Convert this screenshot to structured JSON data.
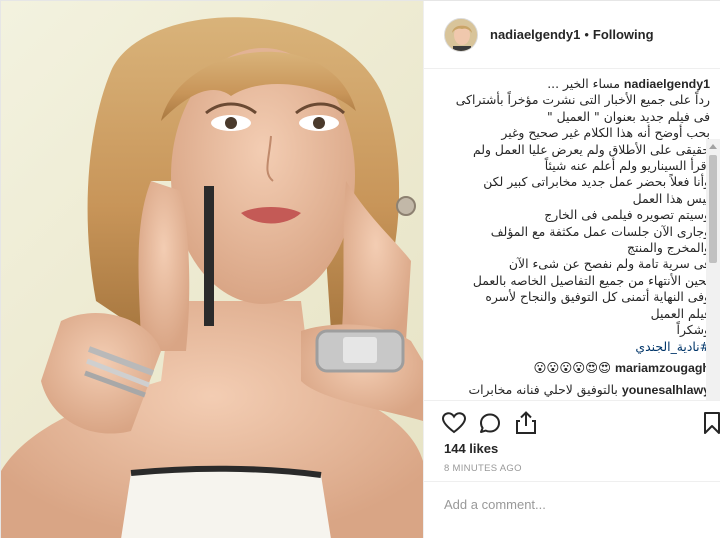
{
  "header": {
    "username": "nadiaelgendy1",
    "separator": "•",
    "follow_status": "Following"
  },
  "caption": {
    "username": "nadiaelgendy1",
    "lines": [
      "مساء الخير ...",
      "رداً على جميع الأخبار التى نشرت مؤخراً بأشتراكى",
      "فى فيلم جديد بعنوان \" العميل \"",
      "بحب أوضح أنه هذا الكلام غير صحيح وغير",
      "حقيقى على الأطلاق ولم يعرض عليا العمل ولم",
      "أقرأ السيناريو ولم أعلم عنه شيئاً",
      "وأنا فعلاً بحضر عمل جديد مخابراتى كبير لكن",
      "ليس هذا العمل",
      "وسيتم تصويره فيلمى فى الخارج",
      "وجارى الآن جلسات عمل مكثفة مع المؤلف",
      "والمخرج والمنتج",
      "فى سرية تامة ولم نفصح عن شىء الآن",
      "لحين الأنتهاء من جميع التفاصيل الخاصه بالعمل",
      "وفى النهاية أتمنى كل التوفيق والنجاح لأسره",
      "فيلم العميل",
      "وشكراً"
    ],
    "hashtag": "#نادية_الجندي"
  },
  "comments": [
    {
      "username": "mariamzougagh",
      "text": "😍😍😮😮😮😮"
    },
    {
      "username": "younesalhlawy",
      "text": "بالتوفيق لاحلي فنانه مخابرات"
    }
  ],
  "actions": {
    "like_icon": "heart-icon",
    "comment_icon": "comment-icon",
    "share_icon": "share-icon",
    "save_icon": "bookmark-icon"
  },
  "likes": "144 likes",
  "timestamp": "8 MINUTES AGO",
  "add_comment": {
    "placeholder": "Add a comment..."
  },
  "colors": {
    "text": "#262626",
    "muted": "#999999",
    "border": "#efefef",
    "hashtag": "#003569"
  }
}
